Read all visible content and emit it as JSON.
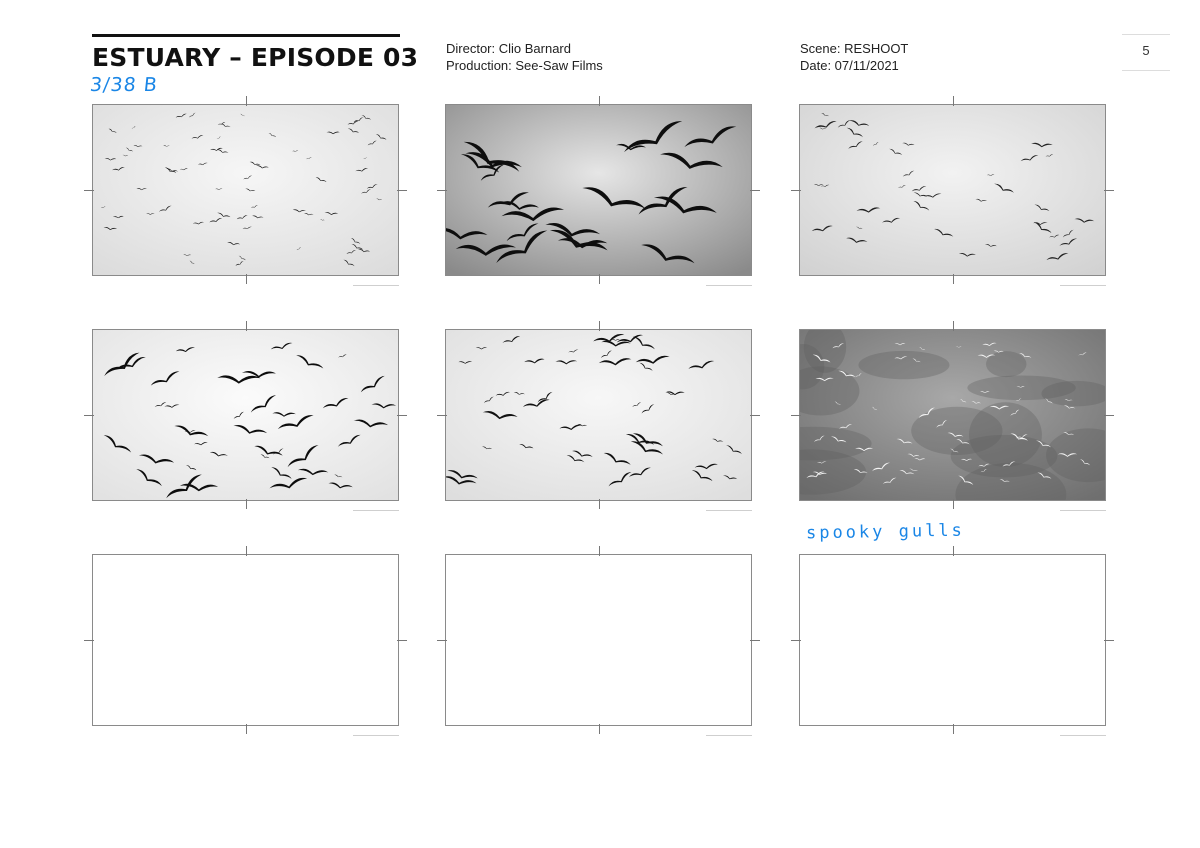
{
  "header": {
    "title": "ESTUARY – EPISODE 03",
    "shot_number": "3/38 B",
    "director": "Director: Clio Barnard",
    "production": "Production: See-Saw Films",
    "scene": "Scene: RESHOOT",
    "date": "Date: 07/11/2021",
    "page_number": "5"
  },
  "note": "spooky gulls",
  "colors": {
    "annotation_blue": "#1a86e6",
    "ink": "#111111",
    "frame_border": "#8a8a8a"
  },
  "panels": [
    {
      "index": 1,
      "content": "sketch",
      "description_icon": "distant-flock-sketch"
    },
    {
      "index": 2,
      "content": "sketch",
      "description_icon": "close-gulls-sketch"
    },
    {
      "index": 3,
      "content": "sketch",
      "description_icon": "gulls-wide-sketch"
    },
    {
      "index": 4,
      "content": "sketch",
      "description_icon": "gull-flock-ink-sketch"
    },
    {
      "index": 5,
      "content": "sketch",
      "description_icon": "gull-flock-sky-sketch"
    },
    {
      "index": 6,
      "content": "sketch",
      "description_icon": "white-gulls-dark-sky-sketch"
    },
    {
      "index": 7,
      "content": "empty"
    },
    {
      "index": 8,
      "content": "empty"
    },
    {
      "index": 9,
      "content": "empty"
    }
  ]
}
